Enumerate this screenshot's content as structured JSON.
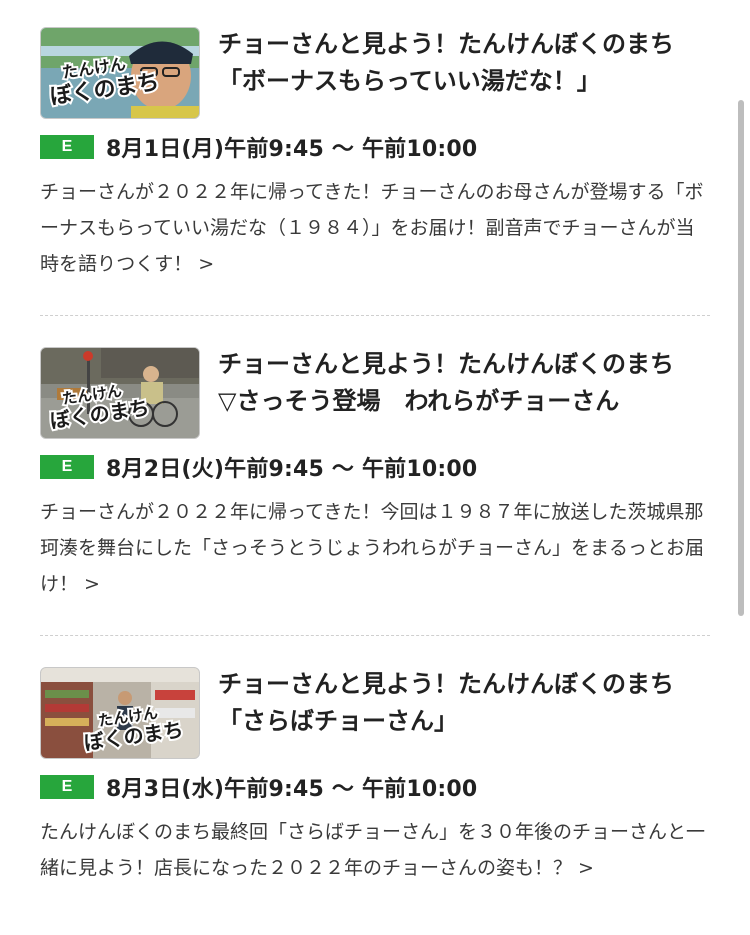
{
  "colors": {
    "badge_green": "#27a63c",
    "text": "#222222",
    "divider": "#cfcfcf"
  },
  "programs": [
    {
      "title": "チョーさんと見よう！たんけんぼくのまち\n「ボーナスもらっていい湯だな！」",
      "badge": "E",
      "datetime": "8月1日(月)午前9:45 ～ 午前10:00",
      "description": "チョーさんが２０２２年に帰ってきた！チョーさんのお母さんが登場する「ボーナスもらっていい湯だな（１９８４）」をお届け！副音声でチョーさんが当時を語りつくす！",
      "more": ">",
      "thumb_logo": "たんけん ぼくのまち"
    },
    {
      "title": "チョーさんと見よう！たんけんぼくのまち\n▽さっそう登場　われらがチョーさん",
      "badge": "E",
      "datetime": "8月2日(火)午前9:45 ～ 午前10:00",
      "description": "チョーさんが２０２２年に帰ってきた！今回は１９８７年に放送した茨城県那珂湊を舞台にした「さっそうとうじょうわれらがチョーさん」をまるっとお届け！",
      "more": ">",
      "thumb_logo": "たんけん ぼくのまち"
    },
    {
      "title": "チョーさんと見よう！たんけんぼくのまち\n「さらばチョーさん」",
      "badge": "E",
      "datetime": "8月3日(水)午前9:45 ～ 午前10:00",
      "description": "たんけんぼくのまち最終回「さらばチョーさん」を３０年後のチョーさんと一緒に見よう！店長になった２０２２年のチョーさんの姿も！？",
      "more": ">",
      "thumb_logo": "たんけん ぼくのまち"
    }
  ]
}
